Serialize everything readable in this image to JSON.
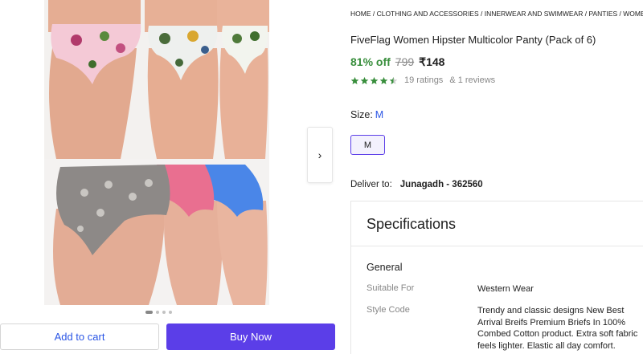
{
  "gallery": {
    "next_icon": "chevron-right-icon",
    "next_glyph": "›",
    "dots_count": 4,
    "active_dot": 0
  },
  "actions": {
    "add_to_cart": "Add to cart",
    "buy_now": "Buy Now"
  },
  "breadcrumb": "HOME / CLOTHING AND ACCESSORIES / INNERWEAR AND SWIMWEAR / PANTIES / WOMEN'S PANTIES",
  "product": {
    "title": "FiveFlag Women Hipster Multicolor Panty (Pack of 6)",
    "discount": "81% off",
    "mrp": "799",
    "price": "₹148",
    "rating_value": 4.5,
    "ratings_text": "19 ratings",
    "reviews_text": "& 1 reviews"
  },
  "size": {
    "label": "Size:",
    "selected": "M",
    "options": [
      "M"
    ]
  },
  "delivery": {
    "label": "Deliver to:",
    "location": "Junagadh - 362560"
  },
  "specifications": {
    "title": "Specifications",
    "group": "General",
    "rows": [
      {
        "key": "Suitable For",
        "value": "Western Wear"
      },
      {
        "key": "Style Code",
        "value": "Trendy and classic designs New Best Arrival Breifs Premium Briefs In 100% Combed Cotton product. Extra soft fabric feels lighter. Elastic all day comfort."
      }
    ]
  },
  "colors": {
    "accent": "#5b3ee8",
    "link": "#2a55e5",
    "discount_green": "#388e3c",
    "star_green": "#388e3c"
  }
}
